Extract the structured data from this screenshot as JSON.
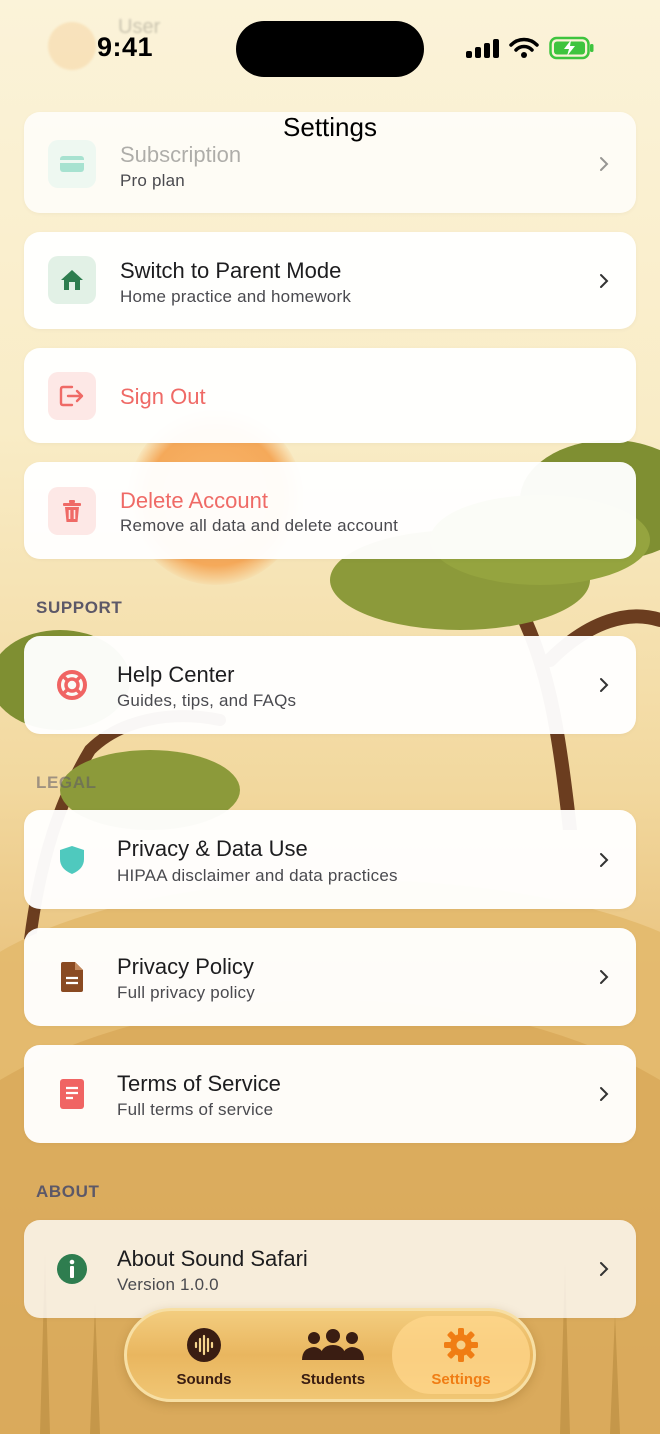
{
  "status_bar": {
    "time": "9:41"
  },
  "header": {
    "title": "Settings",
    "ghost_user_label": "User"
  },
  "account": {
    "subscription": {
      "title": "Subscription",
      "subtitle": "Pro plan"
    },
    "parent_mode": {
      "title": "Switch to Parent Mode",
      "subtitle": "Home practice and homework"
    },
    "sign_out": {
      "title": "Sign Out"
    },
    "delete_account": {
      "title": "Delete Account",
      "subtitle": "Remove all data and delete account"
    }
  },
  "sections": {
    "support": "SUPPORT",
    "legal": "LEGAL",
    "about": "ABOUT"
  },
  "support": {
    "help_center": {
      "title": "Help Center",
      "subtitle": "Guides, tips, and FAQs"
    }
  },
  "legal": {
    "privacy_data": {
      "title": "Privacy & Data Use",
      "subtitle": "HIPAA disclaimer and data practices"
    },
    "privacy_policy": {
      "title": "Privacy Policy",
      "subtitle": "Full privacy policy"
    },
    "terms": {
      "title": "Terms of Service",
      "subtitle": "Full terms of service"
    }
  },
  "about": {
    "app": {
      "title": "About Sound Safari",
      "subtitle": "Version 1.0.0"
    }
  },
  "tab_bar": {
    "tabs": [
      {
        "label": "Sounds",
        "icon": "sound-wave-icon"
      },
      {
        "label": "Students",
        "icon": "people-group-icon"
      },
      {
        "label": "Settings",
        "icon": "gear-icon",
        "active": true
      }
    ]
  },
  "colors": {
    "danger": "#ef6a66",
    "accent": "#f07d14",
    "parent_green": "#2e7d4f",
    "teal": "#4fc9be",
    "brown": "#8a4a22",
    "coral": "#f06463"
  }
}
